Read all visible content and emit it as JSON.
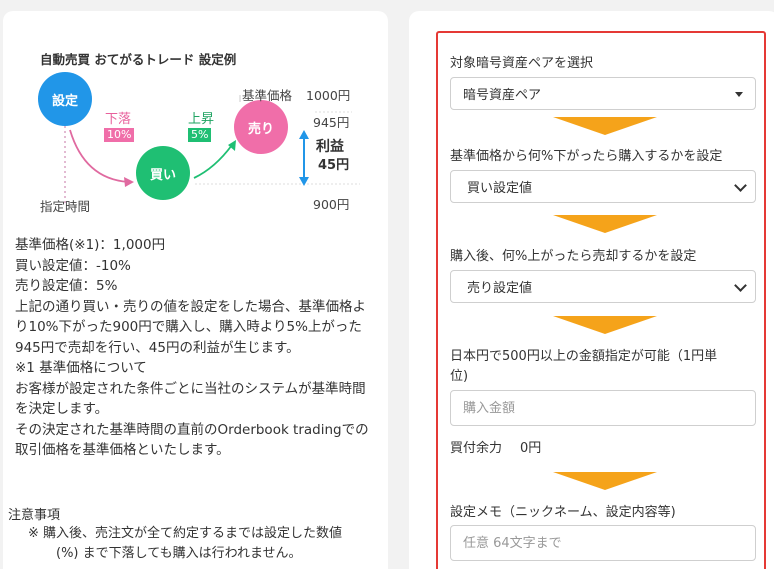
{
  "diagram": {
    "title": "自動売買 おてがるトレード 設定例",
    "circle_settei": "設定",
    "circle_kai": "買い",
    "circle_uri": "売り",
    "label_fall": "下落",
    "badge_fall": "10%",
    "label_rise": "上昇",
    "badge_rise": "5%",
    "base_price_label": "基準価格",
    "base_price_value": "1000円",
    "price_945": "945円",
    "price_900": "900円",
    "profit_label": "利益",
    "profit_value": "45円",
    "designated_time": "指定時間",
    "colors": {
      "settei": "#2196e8",
      "kai": "#1fbf73",
      "uri": "#f06ea9",
      "arrow": "#2196e8"
    }
  },
  "description": {
    "line1": "基準価格(※1)：1,000円",
    "line2": "買い設定値：-10%",
    "line3": "売り設定値：5%",
    "line4": "上記の通り買い・売りの値を設定をした場合、基準価格より10%下がった900円で購入し、購入時より5%上がった945円で売却を行い、45円の利益が生じます。",
    "line5": "※1 基準価格について",
    "line6": "お客様が設定された条件ごとに当社のシステムが基準時間を決定します。",
    "line7": "その決定された基準時間の直前のOrderbook tradingでの取引価格を基準価格といたします。"
  },
  "notes": {
    "title": "注意事項",
    "item1_a": "※ 購入後、売注文が全て約定するまでは設定した数値",
    "item1_b": "(%) まで下落しても購入は行われません。"
  },
  "form": {
    "pair_label": "対象暗号資産ペアを選択",
    "pair_value": "暗号資産ペア",
    "buy_label": "基準価格から何%下がったら購入するかを設定",
    "buy_value": "買い設定値",
    "sell_label": "購入後、何%上がったら売却するかを設定",
    "sell_value": "売り設定値",
    "amount_label_1": "日本円で500円以上の金額指定が可能（1円単",
    "amount_label_2": "位)",
    "amount_placeholder": "購入金額",
    "balance_label": "買付余力",
    "balance_value": "0円",
    "memo_label": "設定メモ（ニックネーム、設定内容等)",
    "memo_placeholder": "任意 64文字まで",
    "arrow_color": "#f5a31a",
    "border_color": "#e53935"
  }
}
